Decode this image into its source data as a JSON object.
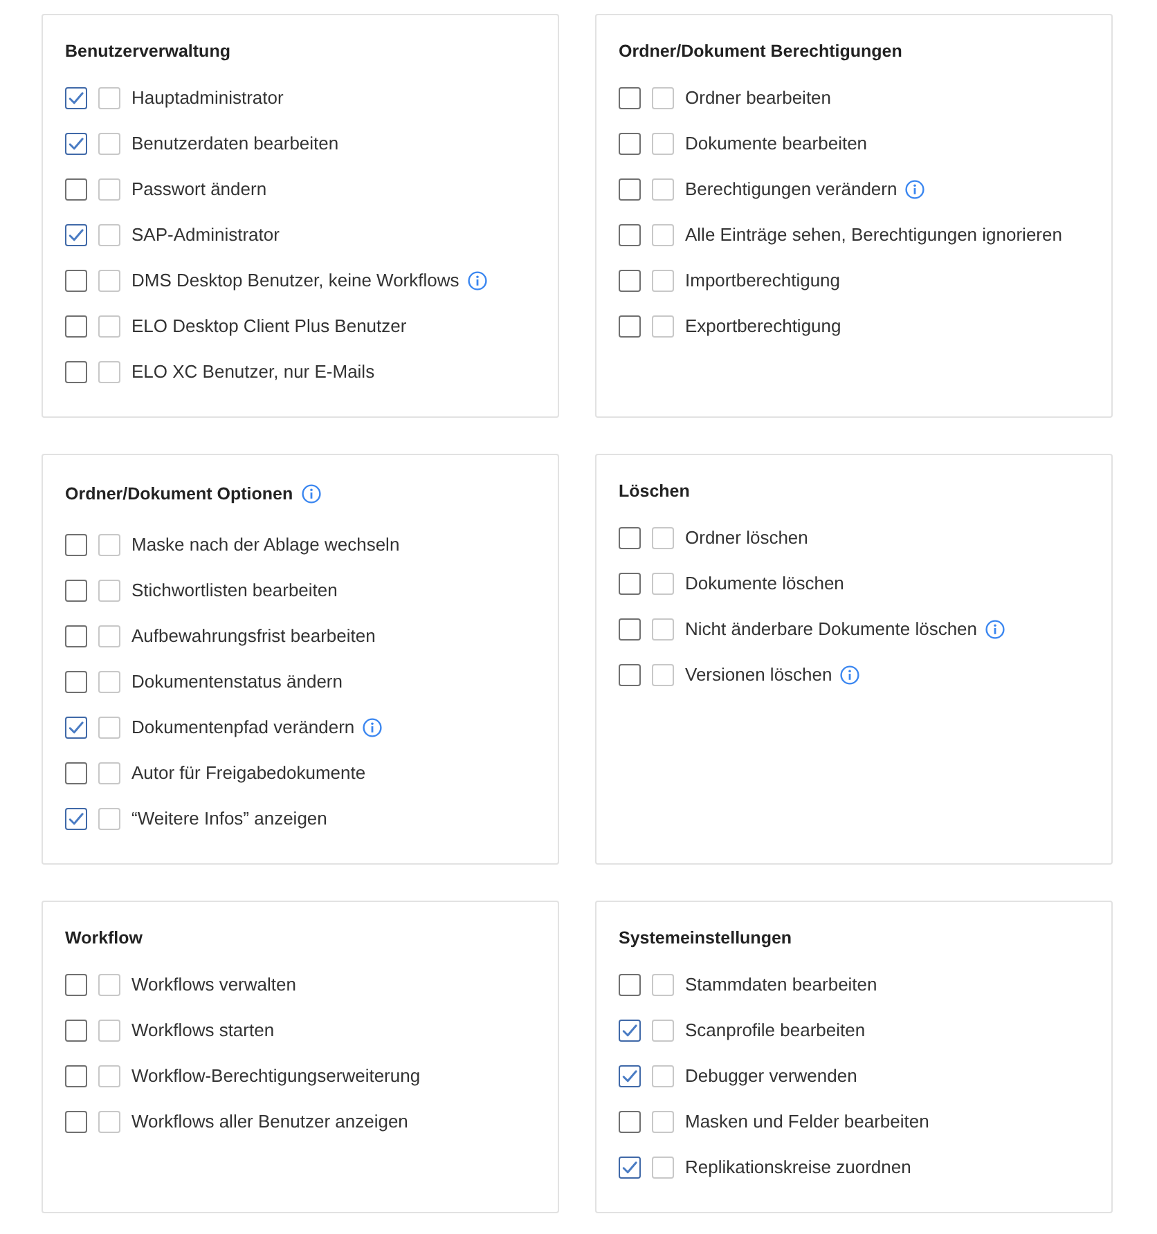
{
  "panels": [
    {
      "title": "Benutzerverwaltung",
      "info": false,
      "options": [
        {
          "label": "Hauptadministrator",
          "checked": true,
          "second_checked": false,
          "info": false
        },
        {
          "label": "Benutzerdaten bearbeiten",
          "checked": true,
          "second_checked": false,
          "info": false
        },
        {
          "label": "Passwort ändern",
          "checked": false,
          "second_checked": false,
          "info": false
        },
        {
          "label": "SAP-Administrator",
          "checked": true,
          "second_checked": false,
          "info": false
        },
        {
          "label": "DMS Desktop Benutzer, keine Workflows",
          "checked": false,
          "second_checked": false,
          "info": true
        },
        {
          "label": "ELO Desktop Client Plus Benutzer",
          "checked": false,
          "second_checked": false,
          "info": false
        },
        {
          "label": "ELO XC Benutzer, nur E-Mails",
          "checked": false,
          "second_checked": false,
          "info": false
        }
      ]
    },
    {
      "title": "Ordner/Dokument Berechtigungen",
      "info": false,
      "options": [
        {
          "label": "Ordner bearbeiten",
          "checked": false,
          "second_checked": false,
          "info": false
        },
        {
          "label": "Dokumente bearbeiten",
          "checked": false,
          "second_checked": false,
          "info": false
        },
        {
          "label": "Berechtigungen verändern",
          "checked": false,
          "second_checked": false,
          "info": true
        },
        {
          "label": "Alle Einträge sehen, Berechtigungen ignorieren",
          "checked": false,
          "second_checked": false,
          "info": false
        },
        {
          "label": "Importberechtigung",
          "checked": false,
          "second_checked": false,
          "info": false
        },
        {
          "label": "Exportberechtigung",
          "checked": false,
          "second_checked": false,
          "info": false
        }
      ]
    },
    {
      "title": "Ordner/Dokument Optionen",
      "info": true,
      "options": [
        {
          "label": "Maske nach der Ablage wechseln",
          "checked": false,
          "second_checked": false,
          "info": false
        },
        {
          "label": "Stichwortlisten bearbeiten",
          "checked": false,
          "second_checked": false,
          "info": false
        },
        {
          "label": "Aufbewahrungsfrist bearbeiten",
          "checked": false,
          "second_checked": false,
          "info": false
        },
        {
          "label": "Dokumentenstatus ändern",
          "checked": false,
          "second_checked": false,
          "info": false
        },
        {
          "label": "Dokumentenpfad verändern",
          "checked": true,
          "second_checked": false,
          "info": true
        },
        {
          "label": "Autor für Freigabedokumente",
          "checked": false,
          "second_checked": false,
          "info": false
        },
        {
          "label": "“Weitere Infos” anzeigen",
          "checked": true,
          "second_checked": false,
          "info": false
        }
      ]
    },
    {
      "title": "Löschen",
      "info": false,
      "options": [
        {
          "label": "Ordner löschen",
          "checked": false,
          "second_checked": false,
          "info": false
        },
        {
          "label": "Dokumente löschen",
          "checked": false,
          "second_checked": false,
          "info": false
        },
        {
          "label": "Nicht änderbare Dokumente löschen",
          "checked": false,
          "second_checked": false,
          "info": true
        },
        {
          "label": "Versionen löschen",
          "checked": false,
          "second_checked": false,
          "info": true
        }
      ]
    },
    {
      "title": "Workflow",
      "info": false,
      "options": [
        {
          "label": "Workflows verwalten",
          "checked": false,
          "second_checked": false,
          "info": false
        },
        {
          "label": "Workflows starten",
          "checked": false,
          "second_checked": false,
          "info": false
        },
        {
          "label": "Workflow-Berechtigungserweiterung",
          "checked": false,
          "second_checked": false,
          "info": false
        },
        {
          "label": "Workflows aller Benutzer anzeigen",
          "checked": false,
          "second_checked": false,
          "info": false
        }
      ]
    },
    {
      "title": "Systemeinstellungen",
      "info": false,
      "options": [
        {
          "label": "Stammdaten bearbeiten",
          "checked": false,
          "second_checked": false,
          "info": false
        },
        {
          "label": "Scanprofile bearbeiten",
          "checked": true,
          "second_checked": false,
          "info": false
        },
        {
          "label": "Debugger verwenden",
          "checked": true,
          "second_checked": false,
          "info": false
        },
        {
          "label": "Masken und Felder bearbeiten",
          "checked": false,
          "second_checked": false,
          "info": false
        },
        {
          "label": "Replikationskreise zuordnen",
          "checked": true,
          "second_checked": false,
          "info": false
        }
      ]
    }
  ]
}
